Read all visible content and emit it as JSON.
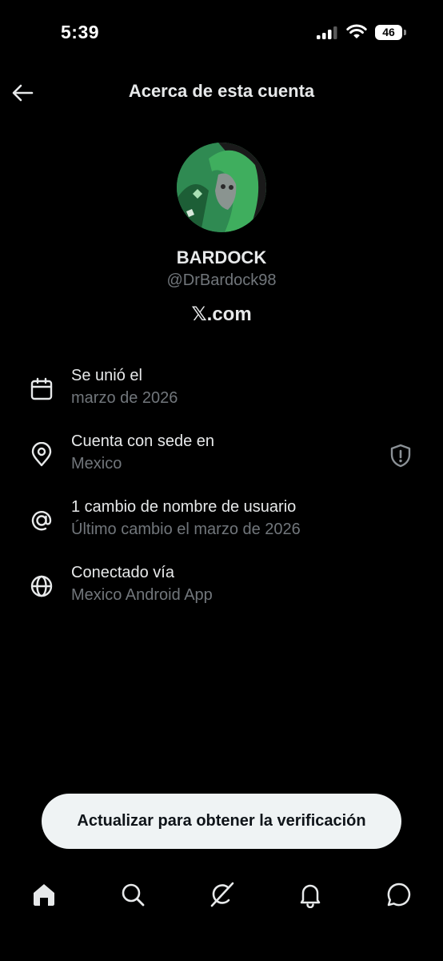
{
  "status_bar": {
    "time": "5:39",
    "battery": "46"
  },
  "header": {
    "title": "Acerca de esta cuenta"
  },
  "profile": {
    "display_name": "BARDOCK",
    "handle": "@DrBardock98",
    "site": "𝕏.com"
  },
  "info": [
    {
      "icon": "calendar-icon",
      "label": "Se unió el",
      "value": "marzo de 2026"
    },
    {
      "icon": "location-pin-icon",
      "label": "Cuenta con sede en",
      "value": "Mexico"
    },
    {
      "icon": "at-sign-icon",
      "label": "1 cambio de nombre de usuario",
      "value": "Último cambio el marzo de 2026"
    },
    {
      "icon": "globe-icon",
      "label": "Conectado vía",
      "value": "Mexico Android App"
    }
  ],
  "upgrade": {
    "label": "Actualizar para obtener la verificación"
  },
  "nav": [
    "home-icon",
    "search-icon",
    "grok-icon",
    "notifications-icon",
    "messages-icon"
  ],
  "colors": {
    "background": "#000000",
    "text_primary": "#e7e9ea",
    "text_secondary": "#71767b",
    "button_bg": "#eff3f4"
  }
}
